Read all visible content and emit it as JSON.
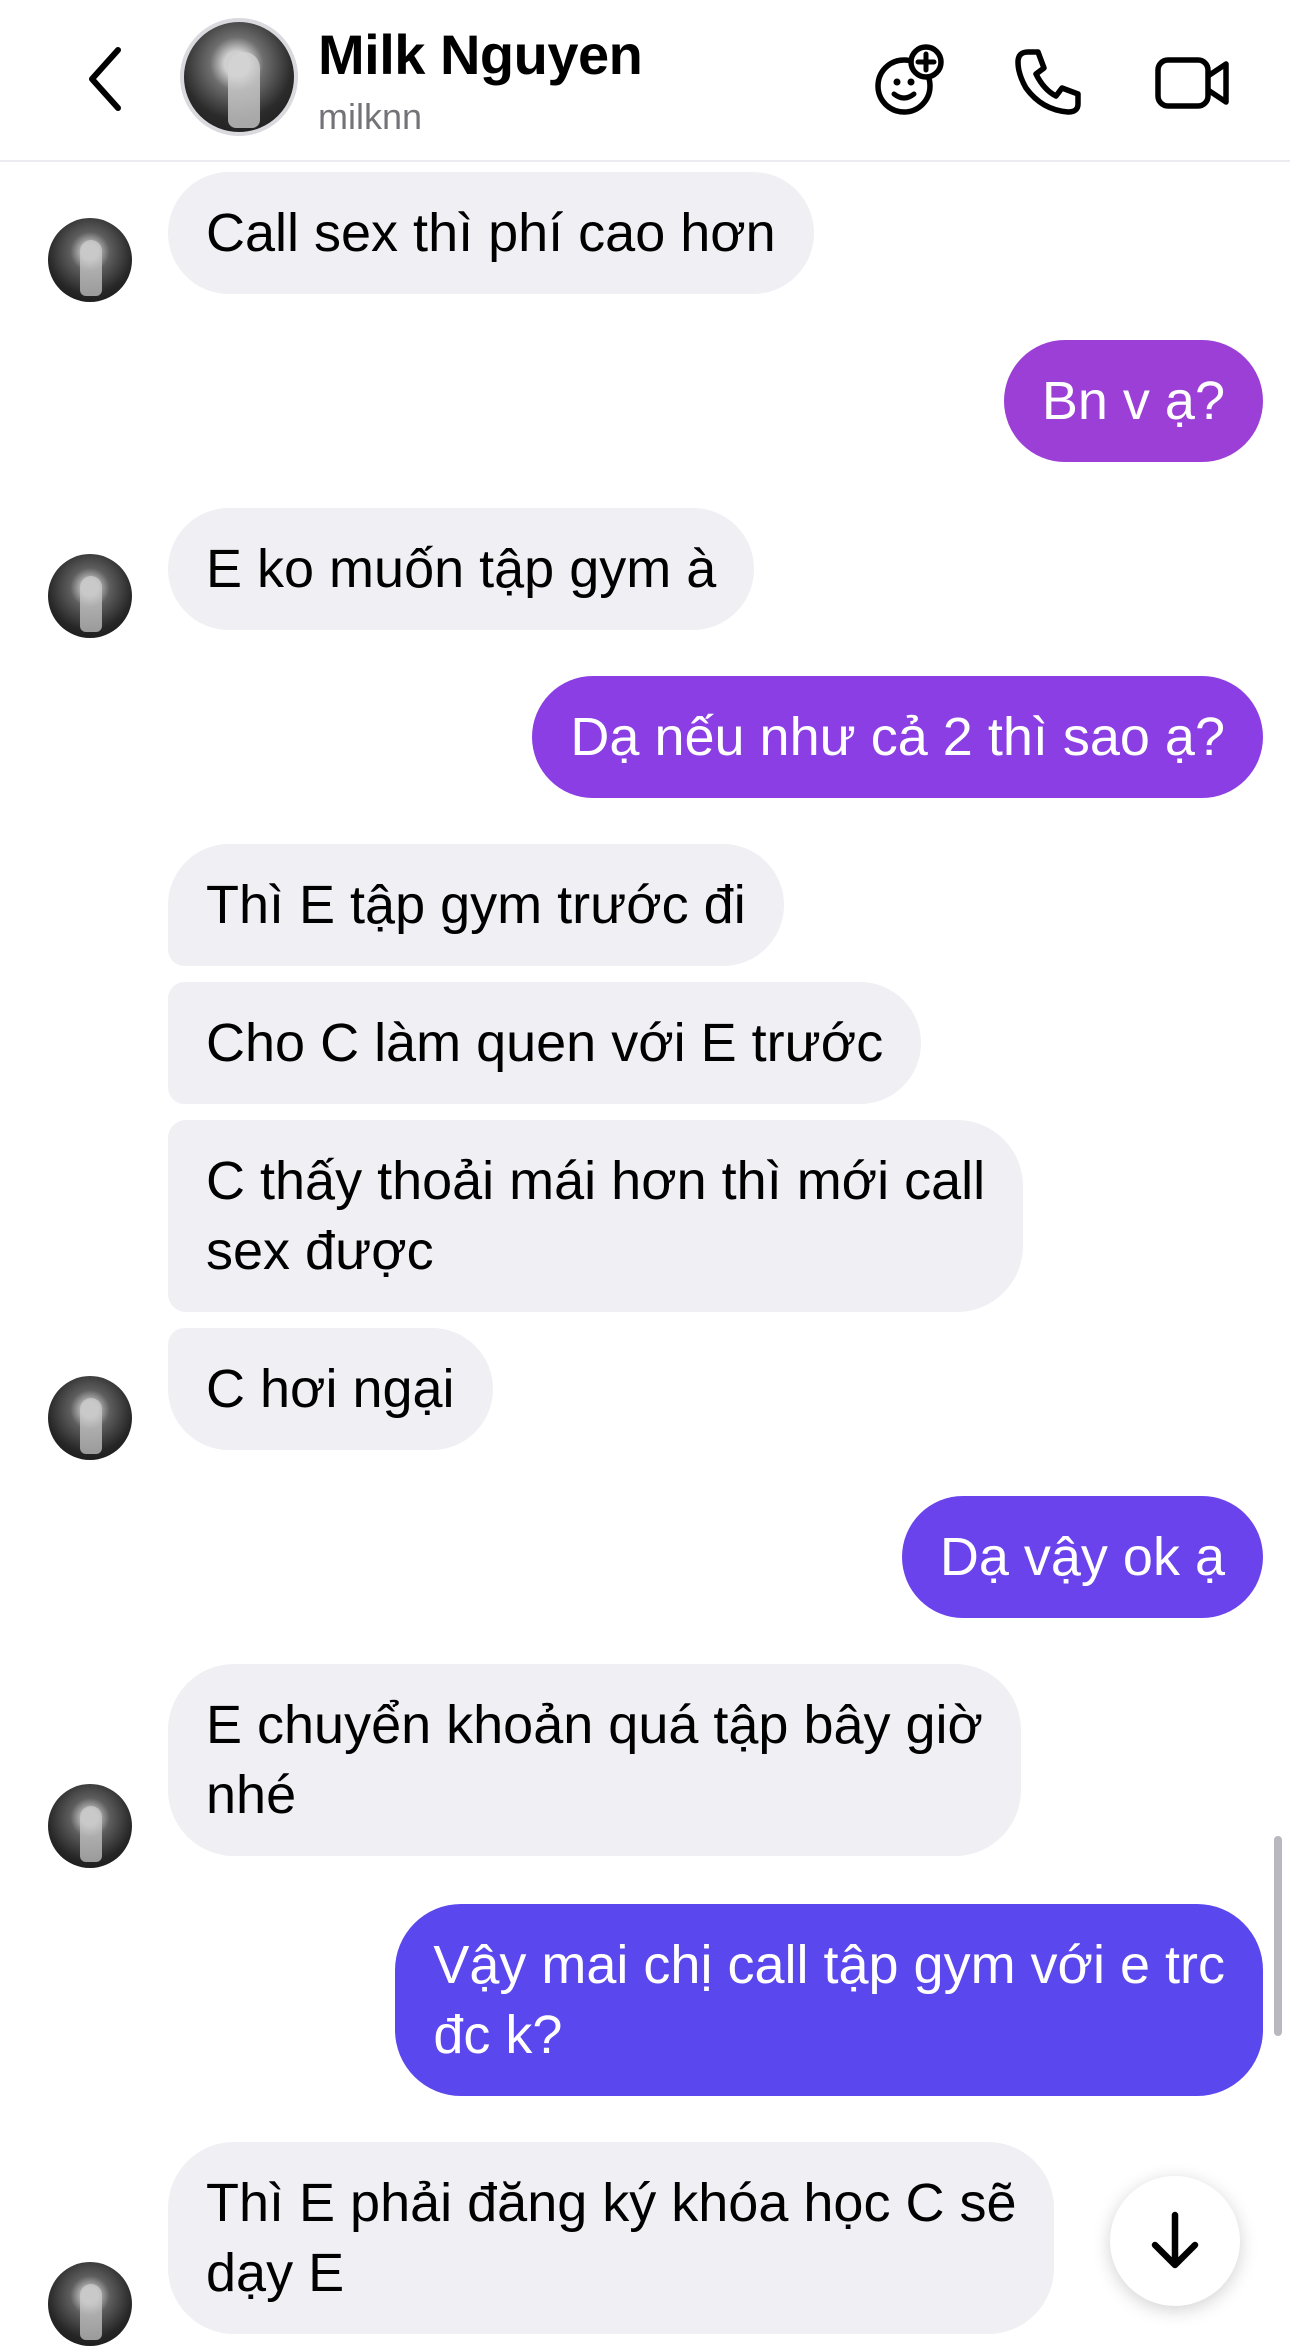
{
  "header": {
    "contact_name": "Milk Nguyen",
    "contact_handle": "milknn",
    "icons": [
      "back-chevron-icon",
      "add-effect-icon",
      "phone-icon",
      "video-call-icon"
    ]
  },
  "messages": [
    {
      "dir": "in",
      "text": "Call sex thì phí cao hơn"
    },
    {
      "dir": "out",
      "text": "Bn v ạ?",
      "color": "#9b3fd6"
    },
    {
      "dir": "in",
      "text": "E ko muốn tập gym à"
    },
    {
      "dir": "out",
      "text": "Dạ nếu như cả 2 thì sao ạ?",
      "color": "#8b3ee3"
    },
    {
      "dir": "in",
      "text": "Thì E tập gym trước đi"
    },
    {
      "dir": "in",
      "text": "Cho C làm quen với E trước"
    },
    {
      "dir": "in",
      "text": "C thấy thoải mái hơn thì mới call\nsex được"
    },
    {
      "dir": "in",
      "text": "C hơi ngại"
    },
    {
      "dir": "out",
      "text": "Dạ vậy ok ạ",
      "color": "#6b43ec"
    },
    {
      "dir": "in",
      "text": "E chuyển khoản quá tập bây giờ\nnhé"
    },
    {
      "dir": "out",
      "text": "Vậy mai chị call tập gym với e trc\nđc k?",
      "color": "#5b47ee"
    },
    {
      "dir": "in",
      "text": "Thì E phải đăng ký khóa học C sẽ\ndạy E"
    }
  ],
  "scroll_button_icon": "arrow-down-icon"
}
